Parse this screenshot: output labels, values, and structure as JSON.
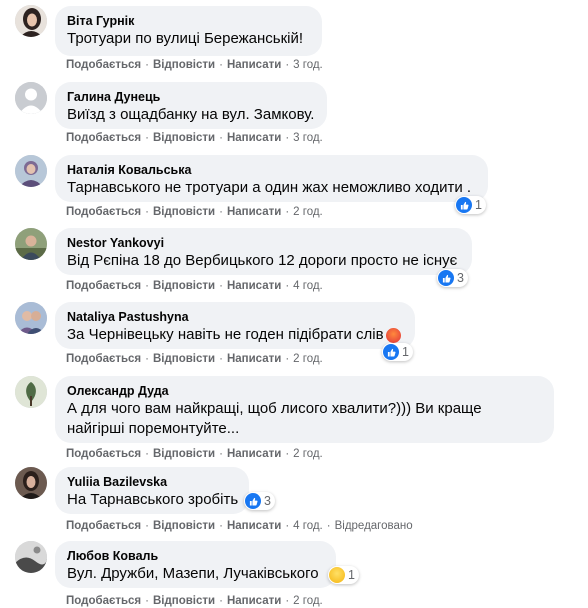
{
  "actions": {
    "like": "Подобається",
    "reply": "Відповісти",
    "write": "Написати",
    "sep": "·"
  },
  "comments": [
    {
      "author": "Віта Гурнік",
      "text": "Тротуари по вулиці Бережанській!",
      "time": "3 год.",
      "avatar_color": "#3a2e2a"
    },
    {
      "author": "Галина Дунець",
      "text": "Виїзд з ощадбанку на вул. Замкову.",
      "time": "3 год.",
      "avatar_color": "#c9ccd1"
    },
    {
      "author": "Наталія Ковальська",
      "text": "Тарнавського не тротуари а один жах неможливо ходити .",
      "time": "2 год.",
      "reaction": {
        "icon": "like-icon",
        "count": "1"
      },
      "avatar_color": "#8a7fa8"
    },
    {
      "author": "Nestor Yankovyi",
      "text": "Від Рєпіна 18 до Вербицького 12 дороги просто не існує",
      "time": "4 год.",
      "reaction": {
        "icon": "like-icon",
        "count": "3"
      },
      "avatar_color": "#6b7a5c"
    },
    {
      "author": "Nataliya Pastushyna",
      "text": "За Чернівецьку навіть не годен підібрати слів",
      "emoji": "angry-face-emoji",
      "time": "2 год.",
      "reaction": {
        "icon": "like-icon",
        "count": "1"
      },
      "avatar_color": "#7a8fb0"
    },
    {
      "author": "Олександр Дуда",
      "text": "А для чого вам найкращі, щоб лисого хвалити?))) Ви краще найгірші поремонтуйте...",
      "time": "2 год.",
      "avatar_color": "#4f6b45"
    },
    {
      "author": "Yuliia Bazilevska",
      "text": "На Тарнавського зробіть",
      "time": "4 год.",
      "edited": "Відредаговано",
      "reaction": {
        "icon": "like-icon",
        "count": "3"
      },
      "avatar_color": "#3d2f2a"
    },
    {
      "author": "Любов Коваль",
      "text": "Вул. Дружби, Мазепи, Лучаківського",
      "time": "2 год.",
      "reaction": {
        "icon": "laugh-emoji",
        "count": "1"
      },
      "avatar_color": "#4a4a4a"
    }
  ]
}
